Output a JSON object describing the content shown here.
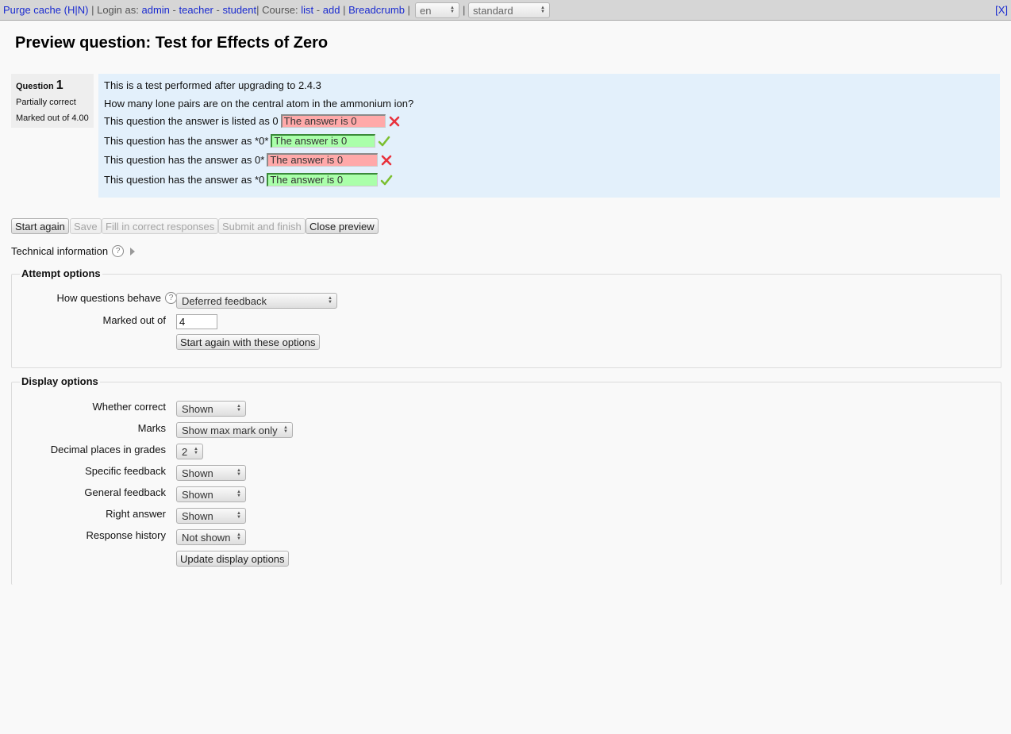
{
  "devbar": {
    "purge_cache": "Purge cache",
    "purge_paren_open": "(",
    "purge_h": "H",
    "purge_sep": "|",
    "purge_n": "N",
    "purge_paren_close": ")",
    "login_as": "| Login as:",
    "admin": "admin",
    "dash1": "-",
    "teacher": "teacher",
    "dash2": "-",
    "student": "student",
    "course": "| Course:",
    "list": "list",
    "dash3": "-",
    "add": "add",
    "pipe1": "|",
    "breadcrumb": "Breadcrumb",
    "pipe2": "|",
    "lang_value": "en",
    "pipe3": "|",
    "theme_value": "standard",
    "close": "[X]"
  },
  "page_title": "Preview question: Test for Effects of Zero",
  "question_info": {
    "label": "Question",
    "number": "1",
    "state": "Partially correct",
    "grade": "Marked out of 4.00"
  },
  "question": {
    "intro": "This is a test performed after upgrading to 2.4.3",
    "prompt": "How many lone pairs are on the central atom in the ammonium ion?",
    "rows": [
      {
        "label": "This question the answer is listed as 0",
        "answer": "The answer is 0",
        "result": "incorrect"
      },
      {
        "label": "This question has the answer as *0*",
        "answer": "The answer is 0",
        "result": "correct"
      },
      {
        "label": "This question has the answer as 0*",
        "answer": "The answer is 0",
        "result": "incorrect"
      },
      {
        "label": "This question has the answer as *0",
        "answer": "The answer is 0",
        "result": "correct"
      }
    ]
  },
  "controls": {
    "start_again": "Start again",
    "save": "Save",
    "fill_correct": "Fill in correct responses",
    "submit_finish": "Submit and finish",
    "close_preview": "Close preview"
  },
  "technical_information": "Technical information",
  "attempt_options": {
    "legend": "Attempt options",
    "behaviour_label": "How questions behave",
    "behaviour_value": "Deferred feedback",
    "marked_out_label": "Marked out of",
    "marked_out_value": "4",
    "start_again_button": "Start again with these options"
  },
  "display_options": {
    "legend": "Display options",
    "whether_correct_label": "Whether correct",
    "whether_correct_value": "Shown",
    "marks_label": "Marks",
    "marks_value": "Show max mark only",
    "decimal_label": "Decimal places in grades",
    "decimal_value": "2",
    "specific_feedback_label": "Specific feedback",
    "specific_feedback_value": "Shown",
    "general_feedback_label": "General feedback",
    "general_feedback_value": "Shown",
    "right_answer_label": "Right answer",
    "right_answer_value": "Shown",
    "response_history_label": "Response history",
    "response_history_value": "Not shown",
    "update_button": "Update display options"
  },
  "colors": {
    "incorrect_bg": "#ffa9a9",
    "correct_bg": "#aaffaa",
    "content_bg": "#e3f0fb",
    "link": "#1a2bd0"
  },
  "icons": {
    "incorrect": "cross-icon",
    "correct": "check-icon",
    "help": "help-icon"
  }
}
